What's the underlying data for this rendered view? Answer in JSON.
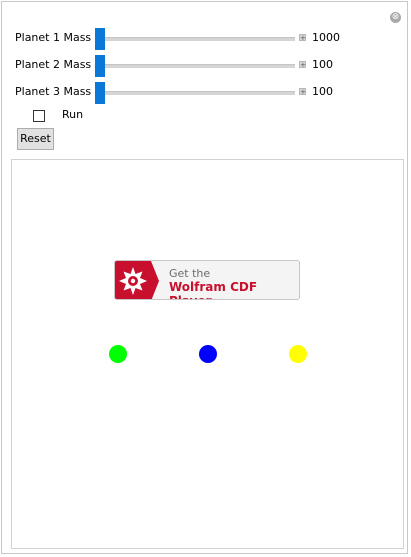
{
  "controls": {
    "close_icon": "⊗",
    "sliders": [
      {
        "label": "Planet 1 Mass",
        "value": "1000",
        "position": 0
      },
      {
        "label": "Planet 2 Mass",
        "value": "100",
        "position": 0
      },
      {
        "label": "Planet 3 Mass",
        "value": "100",
        "position": 0
      }
    ],
    "plus_icon": "+",
    "run_label": "Run",
    "run_checked": false,
    "reset_label": "Reset"
  },
  "canvas": {
    "banner": {
      "line1": "Get the",
      "line2": "Wolfram CDF Player",
      "icon": "wolfram-spikey-icon",
      "brand_color": "#c8102e"
    },
    "planets": [
      {
        "name": "planet-1",
        "color": "#00ff00"
      },
      {
        "name": "planet-2",
        "color": "#0000ff"
      },
      {
        "name": "planet-3",
        "color": "#ffff00"
      }
    ]
  }
}
